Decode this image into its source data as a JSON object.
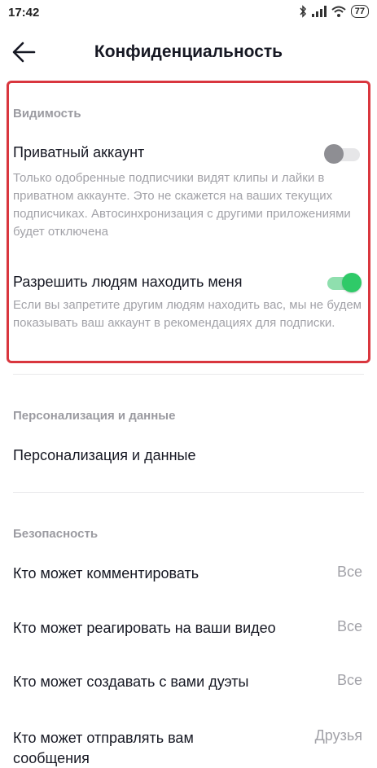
{
  "status_bar": {
    "time": "17:42",
    "battery": "77",
    "icons": [
      "bluetooth-icon",
      "signal-icon",
      "wifi-icon",
      "battery-icon"
    ]
  },
  "header": {
    "title": "Конфиденциальность",
    "back_icon": "arrow-left-icon"
  },
  "visibility": {
    "section_title": "Видимость",
    "private_account": {
      "label": "Приватный аккаунт",
      "enabled": false,
      "description": "Только одобренные подписчики видят клипы и лайки в приватном аккаунте. Это не скажется на ваших текущих подписчиках. Автосинхронизация с другими приложениями будет отключена"
    },
    "allow_find": {
      "label": "Разрешить людям находить меня",
      "enabled": true,
      "description": "Если вы запретите другим людям находить вас, мы не будем показывать ваш аккаунт в рекомендациях для подписки."
    }
  },
  "personalization": {
    "section_title": "Персонализация и данные",
    "item_label": "Персонализация и данные"
  },
  "security": {
    "section_title": "Безопасность",
    "items": [
      {
        "label": "Кто может комментировать",
        "value": "Все"
      },
      {
        "label": "Кто может реагировать на ваши видео",
        "value": "Все"
      },
      {
        "label": "Кто может создавать с вами дуэты",
        "value": "Все"
      },
      {
        "label": "Кто может отправлять вам сообщения",
        "value": "Друзья"
      }
    ]
  },
  "colors": {
    "highlight_border": "#d9363e",
    "toggle_on": "#2fca68",
    "toggle_off": "#8e8e93",
    "secondary_text": "#a2a2a8"
  }
}
